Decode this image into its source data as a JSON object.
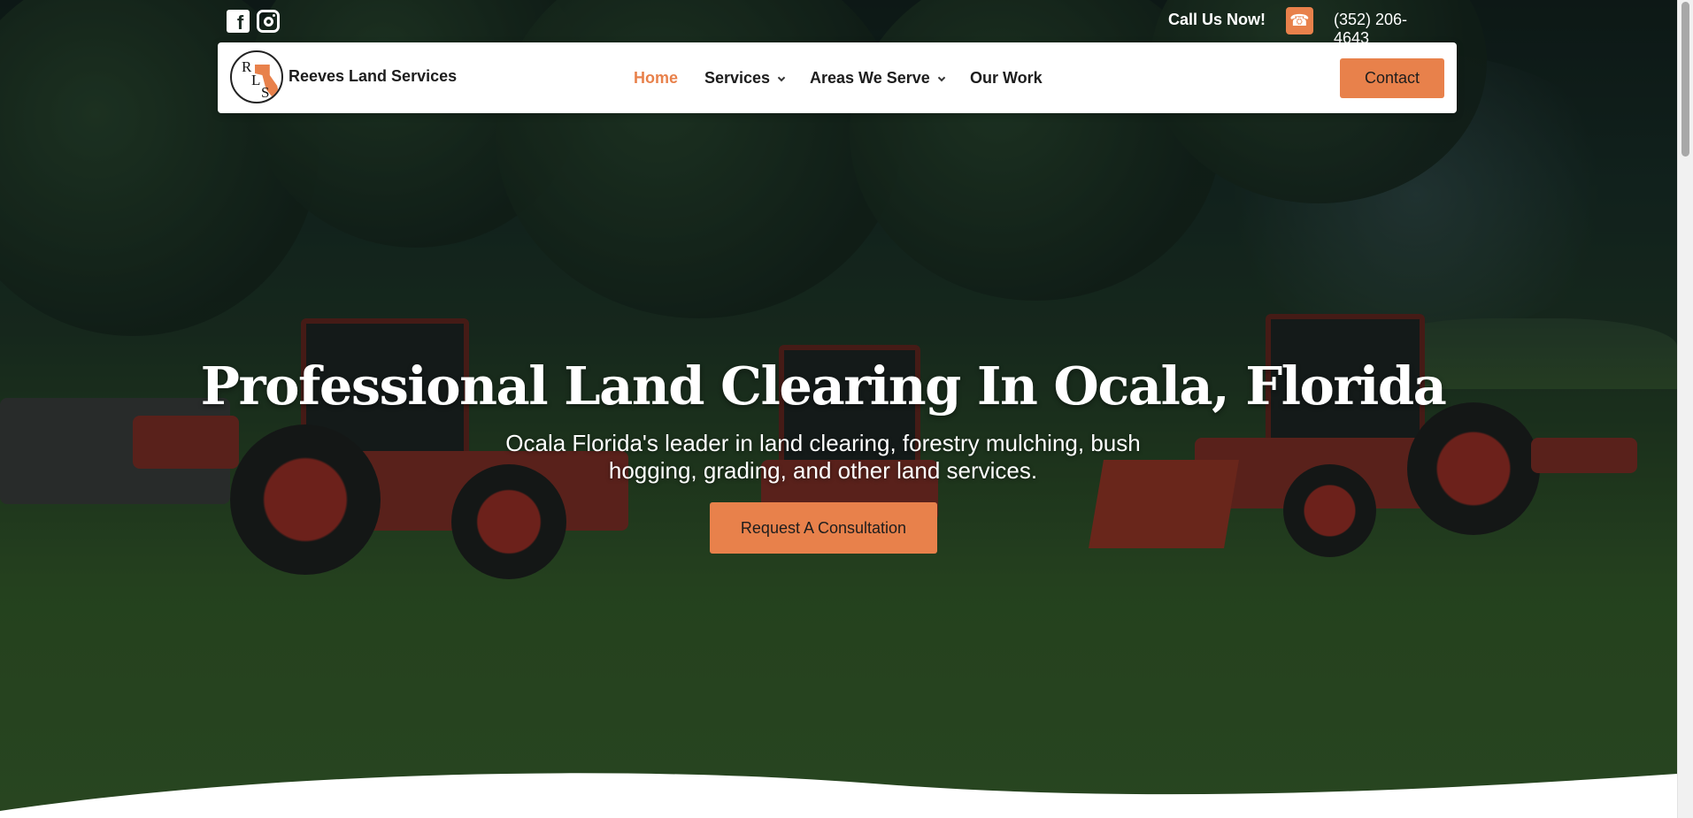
{
  "topbar": {
    "social": [
      "facebook-icon",
      "instagram-icon"
    ],
    "call_label": "Call Us Now!",
    "phone_icon": "phone-icon",
    "phone_number": "(352) 206-4643"
  },
  "brand": {
    "logo_letters": [
      "R",
      "L",
      "S"
    ],
    "name": "Reeves Land Services"
  },
  "nav": {
    "items": [
      {
        "label": "Home",
        "active": true
      },
      {
        "label": "Services",
        "dropdown": true
      },
      {
        "label": "Areas We Serve",
        "dropdown": true
      },
      {
        "label": "Our Work"
      }
    ],
    "contact_label": "Contact"
  },
  "hero": {
    "title": "Professional Land Clearing In Ocala, Florida",
    "subtitle": "Ocala Florida's leader in land clearing, forestry mulching, bush hogging, grading, and other land services.",
    "cta_label": "Request A Consultation"
  },
  "colors": {
    "accent": "#e8814b",
    "text_dark": "#1d1d1d",
    "white": "#ffffff"
  }
}
